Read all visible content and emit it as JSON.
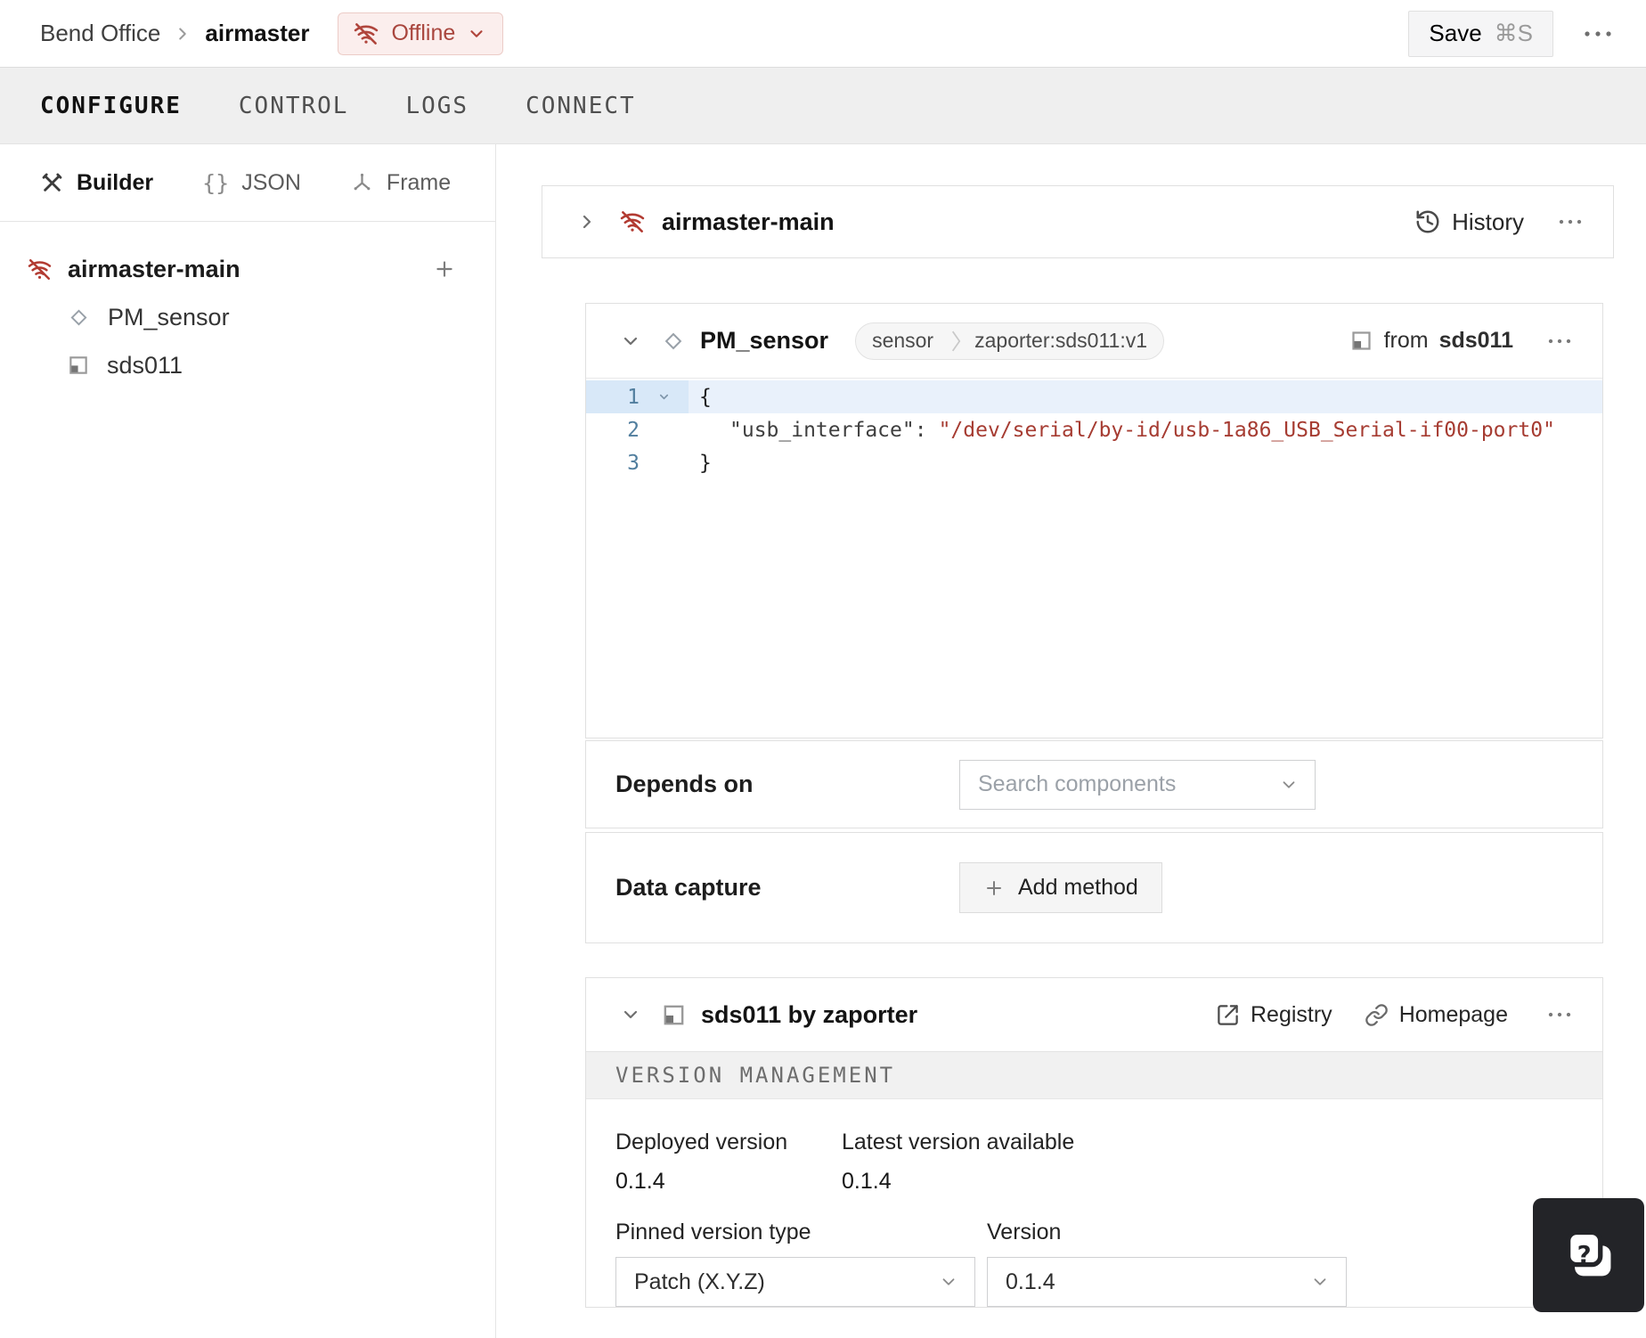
{
  "header": {
    "breadcrumb": {
      "parent": "Bend Office",
      "current": "airmaster"
    },
    "status": "Offline",
    "save_label": "Save",
    "save_shortcut": "⌘S"
  },
  "tabs": [
    {
      "label": "CONFIGURE",
      "active": true
    },
    {
      "label": "CONTROL",
      "active": false
    },
    {
      "label": "LOGS",
      "active": false
    },
    {
      "label": "CONNECT",
      "active": false
    }
  ],
  "sidebar": {
    "views": [
      {
        "label": "Builder"
      },
      {
        "label": "JSON",
        "glyph": "{}"
      },
      {
        "label": "Frame"
      }
    ],
    "tree": {
      "root": "airmaster-main",
      "children": [
        "PM_sensor",
        "sds011"
      ]
    }
  },
  "part_card": {
    "name": "airmaster-main",
    "history": "History"
  },
  "component_card": {
    "name": "PM_sensor",
    "badge_type": "sensor",
    "badge_model": "zaporter:sds011:v1",
    "from_prefix": "from",
    "from_module": "sds011",
    "code": {
      "l1": {
        "num": "1",
        "text": "{"
      },
      "l2": {
        "num": "2",
        "key": "\"usb_interface\":",
        "value": "\"/dev/serial/by-id/usb-1a86_USB_Serial-if00-port0\""
      },
      "l3": {
        "num": "3",
        "text": "}"
      }
    },
    "depends_label": "Depends on",
    "depends_placeholder": "Search components",
    "capture_label": "Data capture",
    "capture_button": "Add method"
  },
  "module_card": {
    "title": "sds011 by zaporter",
    "registry": "Registry",
    "homepage": "Homepage",
    "section": "VERSION MANAGEMENT",
    "deployed_label": "Deployed version",
    "deployed_value": "0.1.4",
    "latest_label": "Latest version available",
    "latest_value": "0.1.4",
    "pinned_label": "Pinned version type",
    "pinned_value": "Patch (X.Y.Z)",
    "version_label": "Version",
    "version_value": "0.1.4"
  },
  "colors": {
    "status_red": "#a9463e",
    "code_string_red": "#a63c32",
    "code_line_number_blue": "#517e9e",
    "tabbar_bg": "#efefef",
    "help_fab_bg": "#232428"
  }
}
